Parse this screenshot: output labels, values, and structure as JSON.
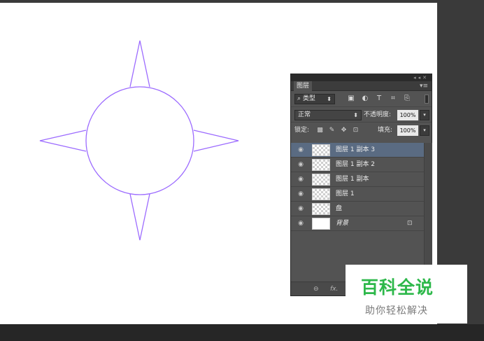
{
  "canvas": {
    "background": "#ffffff",
    "shape_stroke": "#9c6bff"
  },
  "panel": {
    "tab_label": "图层",
    "collapse_icon": "double-arrow-icon",
    "close_icon": "close-icon",
    "menu_icon": "panel-menu-icon",
    "filter": {
      "kind_label": "类型",
      "icons": [
        "image-filter-icon",
        "adjustment-filter-icon",
        "type-filter-icon",
        "shape-filter-icon",
        "smart-object-filter-icon"
      ]
    },
    "blend": {
      "mode": "正常",
      "opacity_label": "不透明度:",
      "opacity_value": "100%"
    },
    "lock": {
      "label": "锁定:",
      "icons": [
        "lock-transparent-icon",
        "lock-image-icon",
        "lock-position-icon",
        "lock-all-icon"
      ],
      "fill_label": "填充:",
      "fill_value": "100%"
    },
    "layers": [
      {
        "name": "图层 1 副本 3",
        "selected": true,
        "thumb": "transparent"
      },
      {
        "name": "图层 1 副本 2",
        "selected": false,
        "thumb": "transparent"
      },
      {
        "name": "图层 1 副本",
        "selected": false,
        "thumb": "transparent"
      },
      {
        "name": "图层 1",
        "selected": false,
        "thumb": "transparent"
      },
      {
        "name": "盘",
        "selected": false,
        "thumb": "transparent"
      },
      {
        "name": "背景",
        "selected": false,
        "thumb": "white",
        "locked": true
      }
    ],
    "footer": {
      "link_icon": "link-icon",
      "fx_label": "fx."
    }
  },
  "watermark": {
    "title": "百科全说",
    "subtitle": "助你轻松解决",
    "title_color": "#2db84a"
  }
}
